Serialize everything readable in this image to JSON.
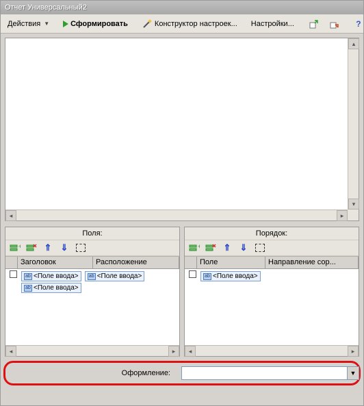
{
  "title": "Отчет  Универсальный2",
  "toolbar": {
    "actions_label": "Действия",
    "form_label": "Сформировать",
    "constructor_label": "Конструктор настроек...",
    "settings_label": "Настройки..."
  },
  "panels": {
    "fields": {
      "title": "Поля:",
      "columns": {
        "check": "",
        "title_col": "Заголовок",
        "layout_col": "Расположение"
      },
      "row": {
        "token1": "<Поле ввода>",
        "token2": "<Поле ввода>",
        "token3": "<Поле ввода>"
      }
    },
    "order": {
      "title": "Порядок:",
      "columns": {
        "check": "",
        "field_col": "Поле",
        "dir_col": "Направление сор..."
      },
      "row": {
        "token1": "<Поле ввода>"
      }
    }
  },
  "bottom": {
    "label": "Оформление:",
    "value": ""
  }
}
